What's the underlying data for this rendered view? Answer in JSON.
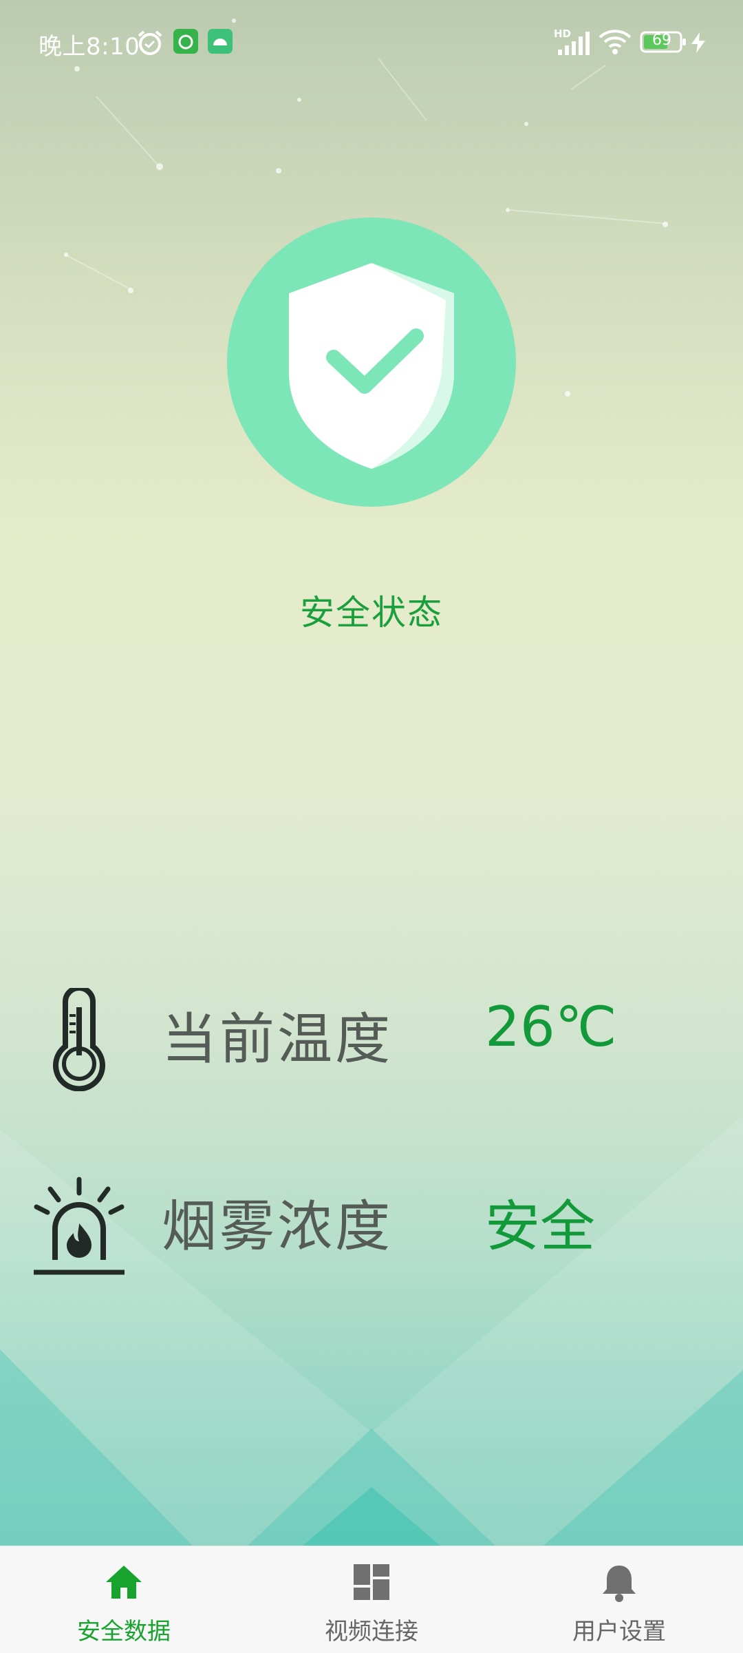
{
  "status_bar": {
    "time": "晚上8:10",
    "network_badge": "HD",
    "battery_level": "69"
  },
  "hero": {
    "icon": "shield-check-icon",
    "status_text": "安全状态"
  },
  "readings": [
    {
      "icon": "thermometer-icon",
      "label": "当前温度",
      "value": "26℃"
    },
    {
      "icon": "alarm-siren-icon",
      "label": "烟雾浓度",
      "value": "安全"
    }
  ],
  "tabs": [
    {
      "icon": "home-icon",
      "label": "安全数据",
      "active": true
    },
    {
      "icon": "dashboard-icon",
      "label": "视频连接",
      "active": false
    },
    {
      "icon": "bell-icon",
      "label": "用户设置",
      "active": false
    }
  ],
  "colors": {
    "accent_green": "#129a3a",
    "active_tab": "#17a32e",
    "shield_circle": "#7de6b8"
  }
}
